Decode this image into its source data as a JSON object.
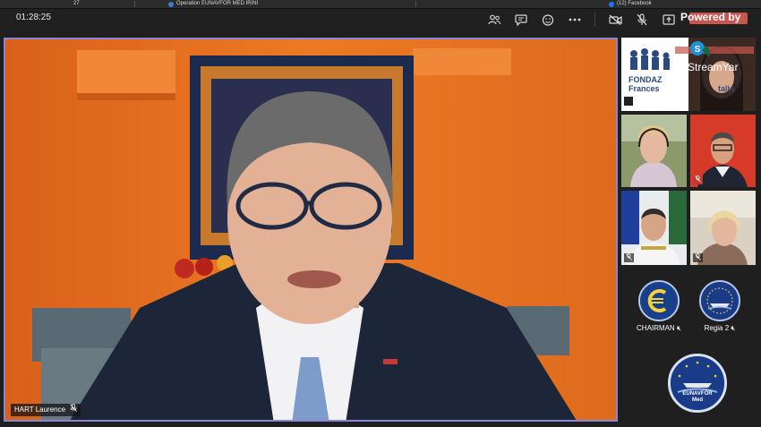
{
  "browser_tabs": [
    {
      "label": "27"
    },
    {
      "label": "Operation EUNAVFOR MED IRINI"
    },
    {
      "label": "(12) Facebook"
    }
  ],
  "toolbar": {
    "timer": "01:28:25",
    "powered_by": "Powered by",
    "icons": [
      "participants-icon",
      "chat-icon",
      "reactions-icon",
      "more-icon",
      "camera-icon",
      "mic-muted-icon",
      "share-icon"
    ]
  },
  "main_speaker": {
    "name": "HART Laurence"
  },
  "side_tiles": {
    "banner_text_1": "FONDAZ",
    "banner_text_2": "Frances",
    "banner_text_3": "talia",
    "streamyard": "StreamYar"
  },
  "participants": [
    {
      "name": "CHAIRMAN"
    },
    {
      "name": "Regia 2"
    }
  ],
  "logo": {
    "org": "EUNAVFOR",
    "sub": "Med"
  },
  "colors": {
    "accent_border": "#8a86d6",
    "wall_orange": "#e8741e",
    "mic_red": "#c0392b"
  }
}
